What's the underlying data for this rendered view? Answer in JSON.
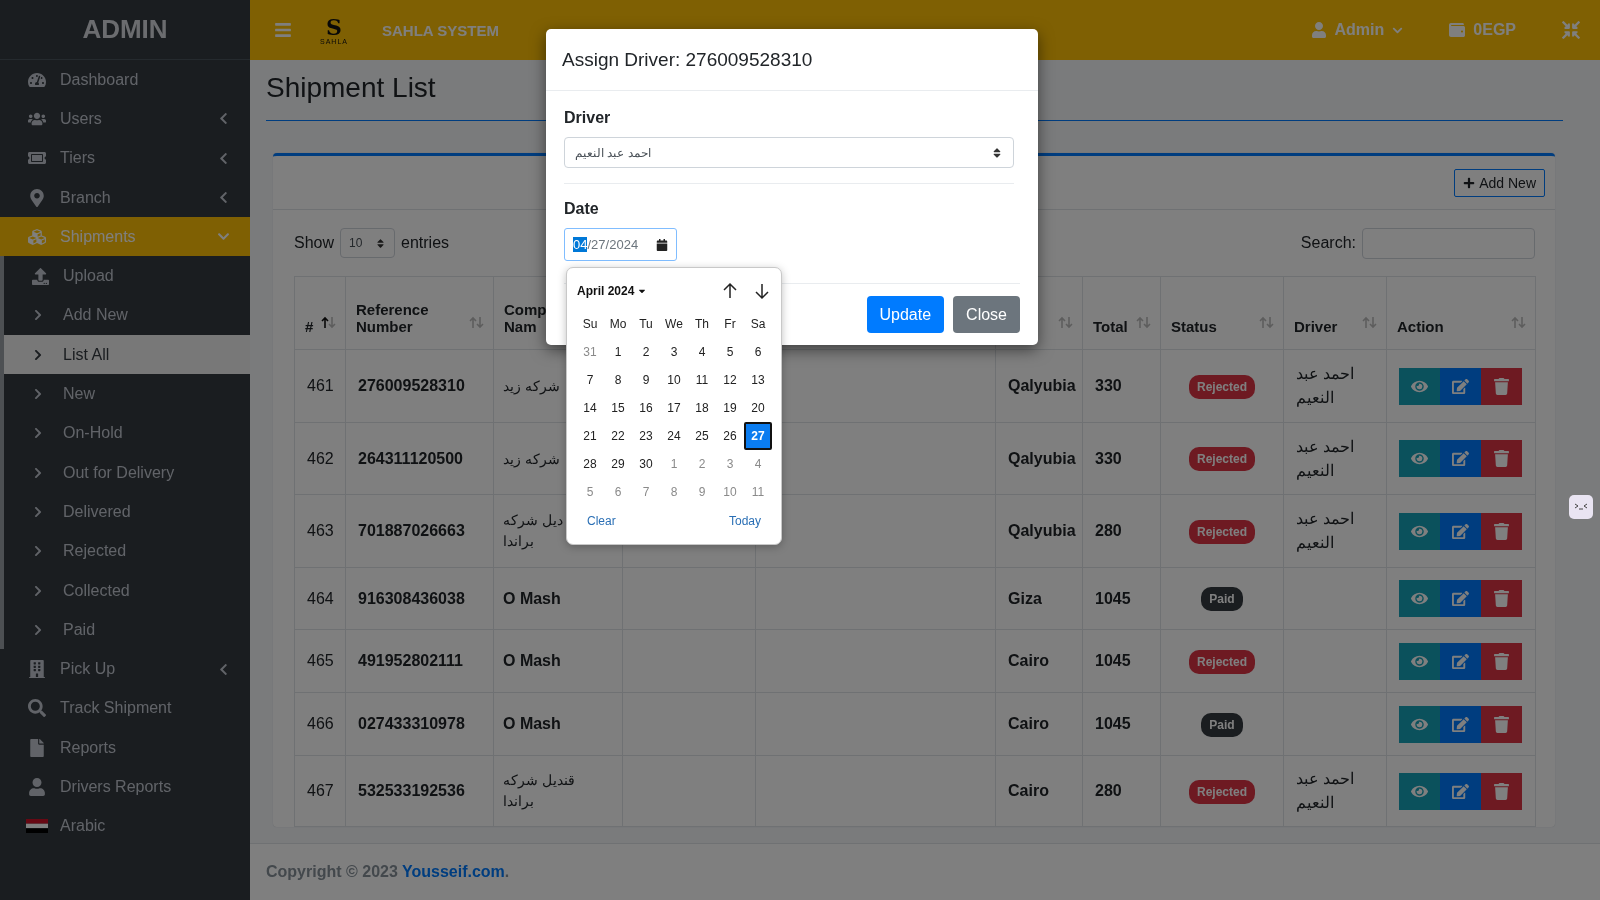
{
  "topbar": {
    "logo": {
      "letter": "S",
      "name": "SAHLA"
    },
    "brand": "SAHLA SYSTEM",
    "user": "Admin",
    "balance": "0EGP"
  },
  "sidebar": {
    "brand": "ADMIN",
    "items": [
      {
        "label": "Dashboard",
        "kind": "link",
        "selected": false
      },
      {
        "label": "Users",
        "kind": "group",
        "expanded": false,
        "selected": false
      },
      {
        "label": "Tiers",
        "kind": "group",
        "expanded": false,
        "selected": false
      },
      {
        "label": "Branch",
        "kind": "group",
        "expanded": false,
        "selected": false
      },
      {
        "label": "Shipments",
        "kind": "group",
        "expanded": true,
        "selected": true,
        "children": [
          {
            "label": "Upload",
            "kind": "page",
            "selected": false
          },
          {
            "label": "Add New",
            "kind": "status",
            "selected": false
          },
          {
            "label": "List All",
            "kind": "status",
            "selected": true
          },
          {
            "label": "New",
            "kind": "status",
            "selected": false
          },
          {
            "label": "On-Hold",
            "kind": "status",
            "selected": false
          },
          {
            "label": "Out for Delivery",
            "kind": "status",
            "selected": false
          },
          {
            "label": "Delivered",
            "kind": "status",
            "selected": false
          },
          {
            "label": "Rejected",
            "kind": "status",
            "selected": false
          },
          {
            "label": "Collected",
            "kind": "status",
            "selected": false
          },
          {
            "label": "Paid",
            "kind": "status",
            "selected": false
          }
        ]
      },
      {
        "label": "Pick Up",
        "kind": "group",
        "expanded": false,
        "selected": false
      },
      {
        "label": "Track Shipment",
        "kind": "link",
        "selected": false
      },
      {
        "label": "Reports",
        "kind": "link",
        "selected": false
      },
      {
        "label": "Drivers Reports",
        "kind": "link",
        "selected": false
      },
      {
        "label": "Arabic",
        "kind": "language",
        "selected": false
      }
    ]
  },
  "page": {
    "title": "Shipment List",
    "add_button": "Add New",
    "length": {
      "show": "Show",
      "value": "10",
      "entries": "entries"
    },
    "search": {
      "label": "Search:"
    }
  },
  "table": {
    "columns": [
      {
        "label": "#",
        "sorted": true
      },
      {
        "label": "Reference Number",
        "sorted": false
      },
      {
        "label": "Comp\nNam"
      },
      null,
      null,
      {
        "sorted": false
      },
      {
        "label": "Total",
        "sorted": false
      },
      {
        "label": "Status",
        "sorted": false
      },
      {
        "label": "Driver",
        "sorted": false
      },
      {
        "label": "Action",
        "sorted": false
      }
    ],
    "rows": [
      {
        "id": "461",
        "reference": "276009528310",
        "company": "شركه زيد",
        "city": "Qalyubia",
        "total": "330",
        "status": {
          "label": "Rejected",
          "kind": "rejected"
        },
        "driver": "احمد عبد النعيم"
      },
      {
        "id": "462",
        "reference": "264311120500",
        "company": "شركه زيد",
        "city": "Qalyubia",
        "total": "330",
        "status": {
          "label": "Rejected",
          "kind": "rejected"
        },
        "driver": "احمد عبد النعيم"
      },
      {
        "id": "463",
        "reference": "701887026663",
        "company": "ديل شركه براندا",
        "city": "Qalyubia",
        "total": "280",
        "status": {
          "label": "Rejected",
          "kind": "rejected"
        },
        "driver": "احمد عبد النعيم"
      },
      {
        "id": "464",
        "reference": "916308436038",
        "company": "O Mash",
        "city": "Giza",
        "total": "1045",
        "status": {
          "label": "Paid",
          "kind": "paid"
        }
      },
      {
        "id": "465",
        "reference": "491952802111",
        "company": "O Mash",
        "city": "Cairo",
        "total": "1045",
        "status": {
          "label": "Rejected",
          "kind": "rejected"
        }
      },
      {
        "id": "466",
        "reference": "027433310978",
        "company": "O Mash",
        "city": "Cairo",
        "total": "1045",
        "status": {
          "label": "Paid",
          "kind": "paid"
        }
      },
      {
        "id": "467",
        "reference": "532533192536",
        "company": "قنديل شركه براندا",
        "city": "Cairo",
        "total": "280",
        "status": {
          "label": "Rejected",
          "kind": "rejected"
        },
        "driver": "احمد عبد النعيم"
      }
    ]
  },
  "footer": {
    "text": "Copyright © 2023 ",
    "link": "Yousseif.com",
    "end": "."
  },
  "modal": {
    "title": "Assign Driver: 276009528310",
    "driver_label": "Driver",
    "driver_value": "احمد عبد النعيم",
    "date_label": "Date",
    "date_segments": [
      {
        "text": "04",
        "selected": true
      },
      {
        "text": "/",
        "selected": false
      },
      {
        "text": "27",
        "selected": false
      },
      {
        "text": "/",
        "selected": false
      },
      {
        "text": "2024",
        "selected": false
      }
    ],
    "buttons": [
      {
        "label": "Update",
        "kind": "primary"
      },
      {
        "label": "Close",
        "kind": "secondary"
      }
    ]
  },
  "datepicker": {
    "month": "April 2024",
    "weekdays": [
      "Su",
      "Mo",
      "Tu",
      "We",
      "Th",
      "Fr",
      "Sa"
    ],
    "weeks": [
      [
        {
          "d": "31",
          "outside": true,
          "selected": false
        },
        {
          "d": "1",
          "outside": false,
          "selected": false
        },
        {
          "d": "2",
          "outside": false,
          "selected": false
        },
        {
          "d": "3",
          "outside": false,
          "selected": false
        },
        {
          "d": "4",
          "outside": false,
          "selected": false
        },
        {
          "d": "5",
          "outside": false,
          "selected": false
        },
        {
          "d": "6",
          "outside": false,
          "selected": false
        }
      ],
      [
        {
          "d": "7",
          "outside": false,
          "selected": false
        },
        {
          "d": "8",
          "outside": false,
          "selected": false
        },
        {
          "d": "9",
          "outside": false,
          "selected": false
        },
        {
          "d": "10",
          "outside": false,
          "selected": false
        },
        {
          "d": "11",
          "outside": false,
          "selected": false
        },
        {
          "d": "12",
          "outside": false,
          "selected": false
        },
        {
          "d": "13",
          "outside": false,
          "selected": false
        }
      ],
      [
        {
          "d": "14",
          "outside": false,
          "selected": false
        },
        {
          "d": "15",
          "outside": false,
          "selected": false
        },
        {
          "d": "16",
          "outside": false,
          "selected": false
        },
        {
          "d": "17",
          "outside": false,
          "selected": false
        },
        {
          "d": "18",
          "outside": false,
          "selected": false
        },
        {
          "d": "19",
          "outside": false,
          "selected": false
        },
        {
          "d": "20",
          "outside": false,
          "selected": false
        }
      ],
      [
        {
          "d": "21",
          "outside": false,
          "selected": false
        },
        {
          "d": "22",
          "outside": false,
          "selected": false
        },
        {
          "d": "23",
          "outside": false,
          "selected": false
        },
        {
          "d": "24",
          "outside": false,
          "selected": false
        },
        {
          "d": "25",
          "outside": false,
          "selected": false
        },
        {
          "d": "26",
          "outside": false,
          "selected": false
        },
        {
          "d": "27",
          "outside": false,
          "selected": true
        }
      ],
      [
        {
          "d": "28",
          "outside": false,
          "selected": false
        },
        {
          "d": "29",
          "outside": false,
          "selected": false
        },
        {
          "d": "30",
          "outside": false,
          "selected": false
        },
        {
          "d": "1",
          "outside": true,
          "selected": false
        },
        {
          "d": "2",
          "outside": true,
          "selected": false
        },
        {
          "d": "3",
          "outside": true,
          "selected": false
        },
        {
          "d": "4",
          "outside": true,
          "selected": false
        }
      ],
      [
        {
          "d": "5",
          "outside": true,
          "selected": false
        },
        {
          "d": "6",
          "outside": true,
          "selected": false
        },
        {
          "d": "7",
          "outside": true,
          "selected": false
        },
        {
          "d": "8",
          "outside": true,
          "selected": false
        },
        {
          "d": "9",
          "outside": true,
          "selected": false
        },
        {
          "d": "10",
          "outside": true,
          "selected": false
        },
        {
          "d": "11",
          "outside": true,
          "selected": false
        }
      ]
    ],
    "clear": "Clear",
    "today": "Today"
  }
}
